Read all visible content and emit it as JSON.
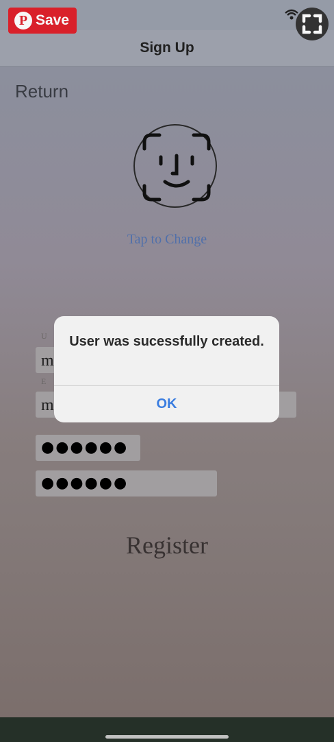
{
  "nav": {
    "title": "Sign Up",
    "back_label": "Return"
  },
  "profile": {
    "change_label": "Tap to Change"
  },
  "form": {
    "field1_label": "U",
    "field1_value": "m",
    "field2_label": "E",
    "field2_value": "m",
    "password_value": "●●●●●●",
    "confirm_value": "●●●●●●",
    "register_label": "Register"
  },
  "overlay": {
    "save_label": "Save",
    "pin_glyph": "P"
  },
  "alert": {
    "message": "User was sucessfully created.",
    "ok_label": "OK"
  },
  "colors": {
    "link": "#5474b0",
    "pinterest": "#e0222c",
    "alert_button": "#3a7de0"
  }
}
